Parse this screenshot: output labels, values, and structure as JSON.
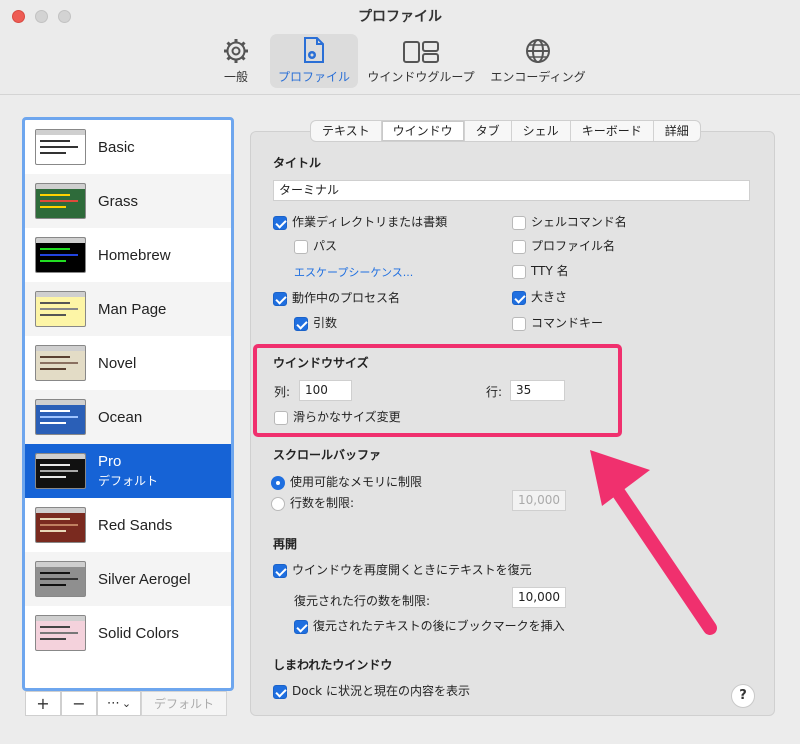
{
  "window": {
    "title": "プロファイル"
  },
  "toolbar": {
    "items": [
      {
        "label": "一般",
        "icon": "gear-icon"
      },
      {
        "label": "プロファイル",
        "icon": "document-gear-icon",
        "active": true
      },
      {
        "label": "ウインドウグループ",
        "icon": "window-group-icon"
      },
      {
        "label": "エンコーディング",
        "icon": "globe-icon"
      }
    ]
  },
  "profiles": [
    {
      "name": "Basic",
      "thumb_bg": "#ffffff",
      "thumb_fg": "#333333"
    },
    {
      "name": "Grass",
      "thumb_bg": "#2e6b3a",
      "thumb_fg": "#ffd200"
    },
    {
      "name": "Homebrew",
      "thumb_bg": "#000000",
      "thumb_fg": "#22dd22"
    },
    {
      "name": "Man Page",
      "thumb_bg": "#fdf5a6",
      "thumb_fg": "#555555"
    },
    {
      "name": "Novel",
      "thumb_bg": "#e3dcc6",
      "thumb_fg": "#5a4030"
    },
    {
      "name": "Ocean",
      "thumb_bg": "#2a5fb7",
      "thumb_fg": "#ffffff"
    },
    {
      "name": "Pro",
      "subtitle": "デフォルト",
      "thumb_bg": "#111111",
      "thumb_fg": "#e8e8e8",
      "selected": true
    },
    {
      "name": "Red Sands",
      "thumb_bg": "#7a2a1f",
      "thumb_fg": "#e8d8b8"
    },
    {
      "name": "Silver Aerogel",
      "thumb_bg": "#8f8f8f",
      "thumb_fg": "#111111"
    },
    {
      "name": "Solid Colors",
      "thumb_bg": "#f4d2dc",
      "thumb_fg": "#444444"
    }
  ],
  "list_tools": {
    "add": "+",
    "remove": "−",
    "more": "⋯",
    "chevron": "⌄",
    "default": "デフォルト"
  },
  "tabs": [
    "テキスト",
    "ウインドウ",
    "タブ",
    "シェル",
    "キーボード",
    "詳細"
  ],
  "active_tab": "ウインドウ",
  "title_section": {
    "heading": "タイトル",
    "title_value": "ターミナル",
    "left_options": [
      {
        "label": "作業ディレクトリまたは書類",
        "checked": true
      },
      {
        "label": "パス",
        "checked": false
      }
    ],
    "escape_link": "エスケープシーケンス...",
    "left_options2": [
      {
        "label": "動作中のプロセス名",
        "checked": true
      },
      {
        "label": "引数",
        "checked": true
      }
    ],
    "right_options": [
      {
        "label": "シェルコマンド名",
        "checked": false
      },
      {
        "label": "プロファイル名",
        "checked": false
      },
      {
        "label": "TTY 名",
        "checked": false
      },
      {
        "label": "大きさ",
        "checked": true
      },
      {
        "label": "コマンドキー",
        "checked": false
      }
    ]
  },
  "window_size": {
    "heading": "ウインドウサイズ",
    "columns_label": "列:",
    "columns_value": "100",
    "rows_label": "行:",
    "rows_value": "35",
    "smooth_resize": "滑らかなサイズ変更"
  },
  "scrollback": {
    "heading": "スクロールバッファ",
    "option_unlimited": "使用可能なメモリに制限",
    "option_limit": "行数を制限:",
    "limit_value": "10,000"
  },
  "reopen": {
    "heading": "再開",
    "restore_text": "ウインドウを再度開くときにテキストを復元",
    "restore_limit_label": "復元された行の数を制限:",
    "restore_limit_value": "10,000",
    "bookmark": "復元されたテキストの後にブックマークを挿入"
  },
  "closed_window": {
    "heading": "しまわれたウインドウ",
    "dock_option": "Dock に状況と現在の内容を表示"
  },
  "help": "?",
  "annotation_color": "#f0306e"
}
